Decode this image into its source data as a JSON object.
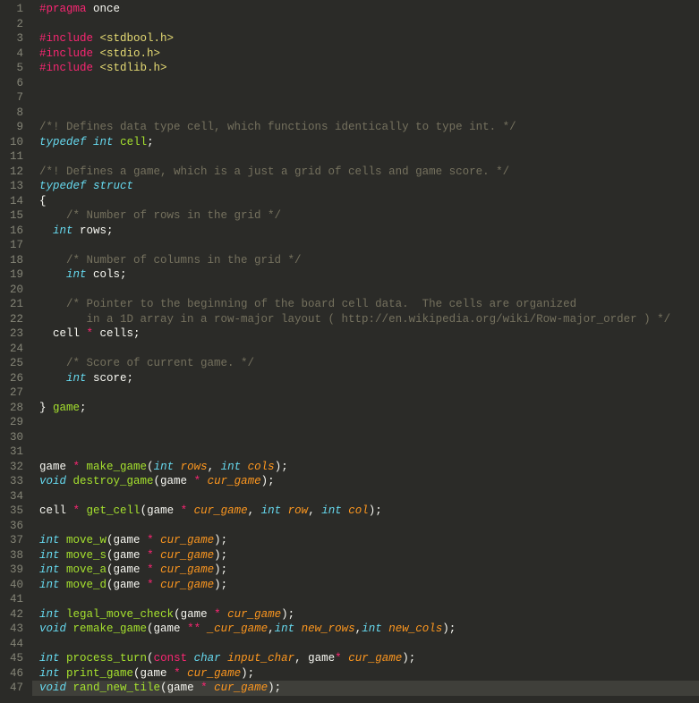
{
  "lines": [
    {
      "num": 1,
      "tokens": [
        {
          "t": "#pragma",
          "c": "k-red"
        },
        {
          "t": " once",
          "c": "k-white"
        }
      ]
    },
    {
      "num": 2,
      "tokens": []
    },
    {
      "num": 3,
      "tokens": [
        {
          "t": "#include",
          "c": "k-red"
        },
        {
          "t": " ",
          "c": ""
        },
        {
          "t": "<stdbool.h>",
          "c": "k-str"
        }
      ]
    },
    {
      "num": 4,
      "tokens": [
        {
          "t": "#include",
          "c": "k-red"
        },
        {
          "t": " ",
          "c": ""
        },
        {
          "t": "<stdio.h>",
          "c": "k-str"
        }
      ]
    },
    {
      "num": 5,
      "tokens": [
        {
          "t": "#include",
          "c": "k-red"
        },
        {
          "t": " ",
          "c": ""
        },
        {
          "t": "<stdlib.h>",
          "c": "k-str"
        }
      ]
    },
    {
      "num": 6,
      "tokens": []
    },
    {
      "num": 7,
      "tokens": []
    },
    {
      "num": 8,
      "tokens": []
    },
    {
      "num": 9,
      "tokens": [
        {
          "t": "/*! Defines data type cell, which functions identically to type int. */",
          "c": "k-cmt"
        }
      ]
    },
    {
      "num": 10,
      "tokens": [
        {
          "t": "typedef",
          "c": "k-teal"
        },
        {
          "t": " ",
          "c": ""
        },
        {
          "t": "int",
          "c": "k-type"
        },
        {
          "t": " ",
          "c": ""
        },
        {
          "t": "cell",
          "c": "k-decl"
        },
        {
          "t": ";",
          "c": "k-white"
        }
      ]
    },
    {
      "num": 11,
      "tokens": []
    },
    {
      "num": 12,
      "tokens": [
        {
          "t": "/*! Defines a game, which is a just a grid of cells and game score. */",
          "c": "k-cmt"
        }
      ]
    },
    {
      "num": 13,
      "tokens": [
        {
          "t": "typedef",
          "c": "k-teal"
        },
        {
          "t": " ",
          "c": ""
        },
        {
          "t": "struct",
          "c": "k-type"
        }
      ]
    },
    {
      "num": 14,
      "tokens": [
        {
          "t": "{",
          "c": "k-white"
        }
      ]
    },
    {
      "num": 15,
      "tokens": [
        {
          "t": "    ",
          "c": ""
        },
        {
          "t": "/* Number of rows in the grid */",
          "c": "k-cmt"
        }
      ]
    },
    {
      "num": 16,
      "tokens": [
        {
          "t": "  ",
          "c": ""
        },
        {
          "t": "int",
          "c": "k-type"
        },
        {
          "t": " rows;",
          "c": "k-white"
        }
      ]
    },
    {
      "num": 17,
      "tokens": []
    },
    {
      "num": 18,
      "tokens": [
        {
          "t": "    ",
          "c": ""
        },
        {
          "t": "/* Number of columns in the grid */",
          "c": "k-cmt"
        }
      ]
    },
    {
      "num": 19,
      "tokens": [
        {
          "t": "    ",
          "c": ""
        },
        {
          "t": "int",
          "c": "k-type"
        },
        {
          "t": " cols;",
          "c": "k-white"
        }
      ]
    },
    {
      "num": 20,
      "tokens": []
    },
    {
      "num": 21,
      "tokens": [
        {
          "t": "    ",
          "c": ""
        },
        {
          "t": "/* Pointer to the beginning of the board cell data.  The cells are organized",
          "c": "k-cmt"
        }
      ]
    },
    {
      "num": 22,
      "tokens": [
        {
          "t": "       in a 1D array in a row-major layout ( http://en.wikipedia.org/wiki/Row-major_order ) */",
          "c": "k-cmt"
        }
      ]
    },
    {
      "num": 23,
      "tokens": [
        {
          "t": "  cell ",
          "c": "k-white"
        },
        {
          "t": "*",
          "c": "k-red"
        },
        {
          "t": " cells;",
          "c": "k-white"
        }
      ]
    },
    {
      "num": 24,
      "tokens": []
    },
    {
      "num": 25,
      "tokens": [
        {
          "t": "    ",
          "c": ""
        },
        {
          "t": "/* Score of current game. */",
          "c": "k-cmt"
        }
      ]
    },
    {
      "num": 26,
      "tokens": [
        {
          "t": "    ",
          "c": ""
        },
        {
          "t": "int",
          "c": "k-type"
        },
        {
          "t": " score;",
          "c": "k-white"
        }
      ]
    },
    {
      "num": 27,
      "tokens": []
    },
    {
      "num": 28,
      "tokens": [
        {
          "t": "} ",
          "c": "k-white"
        },
        {
          "t": "game",
          "c": "k-decl"
        },
        {
          "t": ";",
          "c": "k-white"
        }
      ]
    },
    {
      "num": 29,
      "tokens": []
    },
    {
      "num": 30,
      "tokens": []
    },
    {
      "num": 31,
      "tokens": []
    },
    {
      "num": 32,
      "tokens": [
        {
          "t": "game ",
          "c": "k-white"
        },
        {
          "t": "*",
          "c": "k-red"
        },
        {
          "t": " ",
          "c": ""
        },
        {
          "t": "make_game",
          "c": "k-fn"
        },
        {
          "t": "(",
          "c": "k-white"
        },
        {
          "t": "int",
          "c": "k-type"
        },
        {
          "t": " ",
          "c": ""
        },
        {
          "t": "rows",
          "c": "k-param"
        },
        {
          "t": ", ",
          "c": "k-white"
        },
        {
          "t": "int",
          "c": "k-type"
        },
        {
          "t": " ",
          "c": ""
        },
        {
          "t": "cols",
          "c": "k-param"
        },
        {
          "t": ");",
          "c": "k-white"
        }
      ]
    },
    {
      "num": 33,
      "tokens": [
        {
          "t": "void",
          "c": "k-type"
        },
        {
          "t": " ",
          "c": ""
        },
        {
          "t": "destroy_game",
          "c": "k-fn"
        },
        {
          "t": "(game ",
          "c": "k-white"
        },
        {
          "t": "*",
          "c": "k-red"
        },
        {
          "t": " ",
          "c": ""
        },
        {
          "t": "cur_game",
          "c": "k-param"
        },
        {
          "t": ");",
          "c": "k-white"
        }
      ]
    },
    {
      "num": 34,
      "tokens": []
    },
    {
      "num": 35,
      "tokens": [
        {
          "t": "cell ",
          "c": "k-white"
        },
        {
          "t": "*",
          "c": "k-red"
        },
        {
          "t": " ",
          "c": ""
        },
        {
          "t": "get_cell",
          "c": "k-fn"
        },
        {
          "t": "(game ",
          "c": "k-white"
        },
        {
          "t": "*",
          "c": "k-red"
        },
        {
          "t": " ",
          "c": ""
        },
        {
          "t": "cur_game",
          "c": "k-param"
        },
        {
          "t": ", ",
          "c": "k-white"
        },
        {
          "t": "int",
          "c": "k-type"
        },
        {
          "t": " ",
          "c": ""
        },
        {
          "t": "row",
          "c": "k-param"
        },
        {
          "t": ", ",
          "c": "k-white"
        },
        {
          "t": "int",
          "c": "k-type"
        },
        {
          "t": " ",
          "c": ""
        },
        {
          "t": "col",
          "c": "k-param"
        },
        {
          "t": ");",
          "c": "k-white"
        }
      ]
    },
    {
      "num": 36,
      "tokens": []
    },
    {
      "num": 37,
      "tokens": [
        {
          "t": "int",
          "c": "k-type"
        },
        {
          "t": " ",
          "c": ""
        },
        {
          "t": "move_w",
          "c": "k-fn"
        },
        {
          "t": "(game ",
          "c": "k-white"
        },
        {
          "t": "*",
          "c": "k-red"
        },
        {
          "t": " ",
          "c": ""
        },
        {
          "t": "cur_game",
          "c": "k-param"
        },
        {
          "t": ");",
          "c": "k-white"
        }
      ]
    },
    {
      "num": 38,
      "tokens": [
        {
          "t": "int",
          "c": "k-type"
        },
        {
          "t": " ",
          "c": ""
        },
        {
          "t": "move_s",
          "c": "k-fn"
        },
        {
          "t": "(game ",
          "c": "k-white"
        },
        {
          "t": "*",
          "c": "k-red"
        },
        {
          "t": " ",
          "c": ""
        },
        {
          "t": "cur_game",
          "c": "k-param"
        },
        {
          "t": ");",
          "c": "k-white"
        }
      ]
    },
    {
      "num": 39,
      "tokens": [
        {
          "t": "int",
          "c": "k-type"
        },
        {
          "t": " ",
          "c": ""
        },
        {
          "t": "move_a",
          "c": "k-fn"
        },
        {
          "t": "(game ",
          "c": "k-white"
        },
        {
          "t": "*",
          "c": "k-red"
        },
        {
          "t": " ",
          "c": ""
        },
        {
          "t": "cur_game",
          "c": "k-param"
        },
        {
          "t": ");",
          "c": "k-white"
        }
      ]
    },
    {
      "num": 40,
      "tokens": [
        {
          "t": "int",
          "c": "k-type"
        },
        {
          "t": " ",
          "c": ""
        },
        {
          "t": "move_d",
          "c": "k-fn"
        },
        {
          "t": "(game ",
          "c": "k-white"
        },
        {
          "t": "*",
          "c": "k-red"
        },
        {
          "t": " ",
          "c": ""
        },
        {
          "t": "cur_game",
          "c": "k-param"
        },
        {
          "t": ");",
          "c": "k-white"
        }
      ]
    },
    {
      "num": 41,
      "tokens": []
    },
    {
      "num": 42,
      "tokens": [
        {
          "t": "int",
          "c": "k-type"
        },
        {
          "t": " ",
          "c": ""
        },
        {
          "t": "legal_move_check",
          "c": "k-fn"
        },
        {
          "t": "(game ",
          "c": "k-white"
        },
        {
          "t": "*",
          "c": "k-red"
        },
        {
          "t": " ",
          "c": ""
        },
        {
          "t": "cur_game",
          "c": "k-param"
        },
        {
          "t": ");",
          "c": "k-white"
        }
      ]
    },
    {
      "num": 43,
      "tokens": [
        {
          "t": "void",
          "c": "k-type"
        },
        {
          "t": " ",
          "c": ""
        },
        {
          "t": "remake_game",
          "c": "k-fn"
        },
        {
          "t": "(game ",
          "c": "k-white"
        },
        {
          "t": "**",
          "c": "k-red"
        },
        {
          "t": " ",
          "c": ""
        },
        {
          "t": "_cur_game",
          "c": "k-param"
        },
        {
          "t": ",",
          "c": "k-white"
        },
        {
          "t": "int",
          "c": "k-type"
        },
        {
          "t": " ",
          "c": ""
        },
        {
          "t": "new_rows",
          "c": "k-param"
        },
        {
          "t": ",",
          "c": "k-white"
        },
        {
          "t": "int",
          "c": "k-type"
        },
        {
          "t": " ",
          "c": ""
        },
        {
          "t": "new_cols",
          "c": "k-param"
        },
        {
          "t": ");",
          "c": "k-white"
        }
      ]
    },
    {
      "num": 44,
      "tokens": []
    },
    {
      "num": 45,
      "tokens": [
        {
          "t": "int",
          "c": "k-type"
        },
        {
          "t": " ",
          "c": ""
        },
        {
          "t": "process_turn",
          "c": "k-fn"
        },
        {
          "t": "(",
          "c": "k-white"
        },
        {
          "t": "const",
          "c": "k-red"
        },
        {
          "t": " ",
          "c": ""
        },
        {
          "t": "char",
          "c": "k-type"
        },
        {
          "t": " ",
          "c": ""
        },
        {
          "t": "input_char",
          "c": "k-param"
        },
        {
          "t": ", game",
          "c": "k-white"
        },
        {
          "t": "*",
          "c": "k-red"
        },
        {
          "t": " ",
          "c": ""
        },
        {
          "t": "cur_game",
          "c": "k-param"
        },
        {
          "t": ");",
          "c": "k-white"
        }
      ]
    },
    {
      "num": 46,
      "tokens": [
        {
          "t": "int",
          "c": "k-type"
        },
        {
          "t": " ",
          "c": ""
        },
        {
          "t": "print_game",
          "c": "k-fn"
        },
        {
          "t": "(game ",
          "c": "k-white"
        },
        {
          "t": "*",
          "c": "k-red"
        },
        {
          "t": " ",
          "c": ""
        },
        {
          "t": "cur_game",
          "c": "k-param"
        },
        {
          "t": ");",
          "c": "k-white"
        }
      ]
    },
    {
      "num": 47,
      "hl": true,
      "tokens": [
        {
          "t": "void",
          "c": "k-type"
        },
        {
          "t": " ",
          "c": ""
        },
        {
          "t": "rand_new_tile",
          "c": "k-fn"
        },
        {
          "t": "(game ",
          "c": "k-white"
        },
        {
          "t": "*",
          "c": "k-red"
        },
        {
          "t": " ",
          "c": ""
        },
        {
          "t": "cur_game",
          "c": "k-param"
        },
        {
          "t": ");",
          "c": "k-white"
        }
      ]
    }
  ]
}
